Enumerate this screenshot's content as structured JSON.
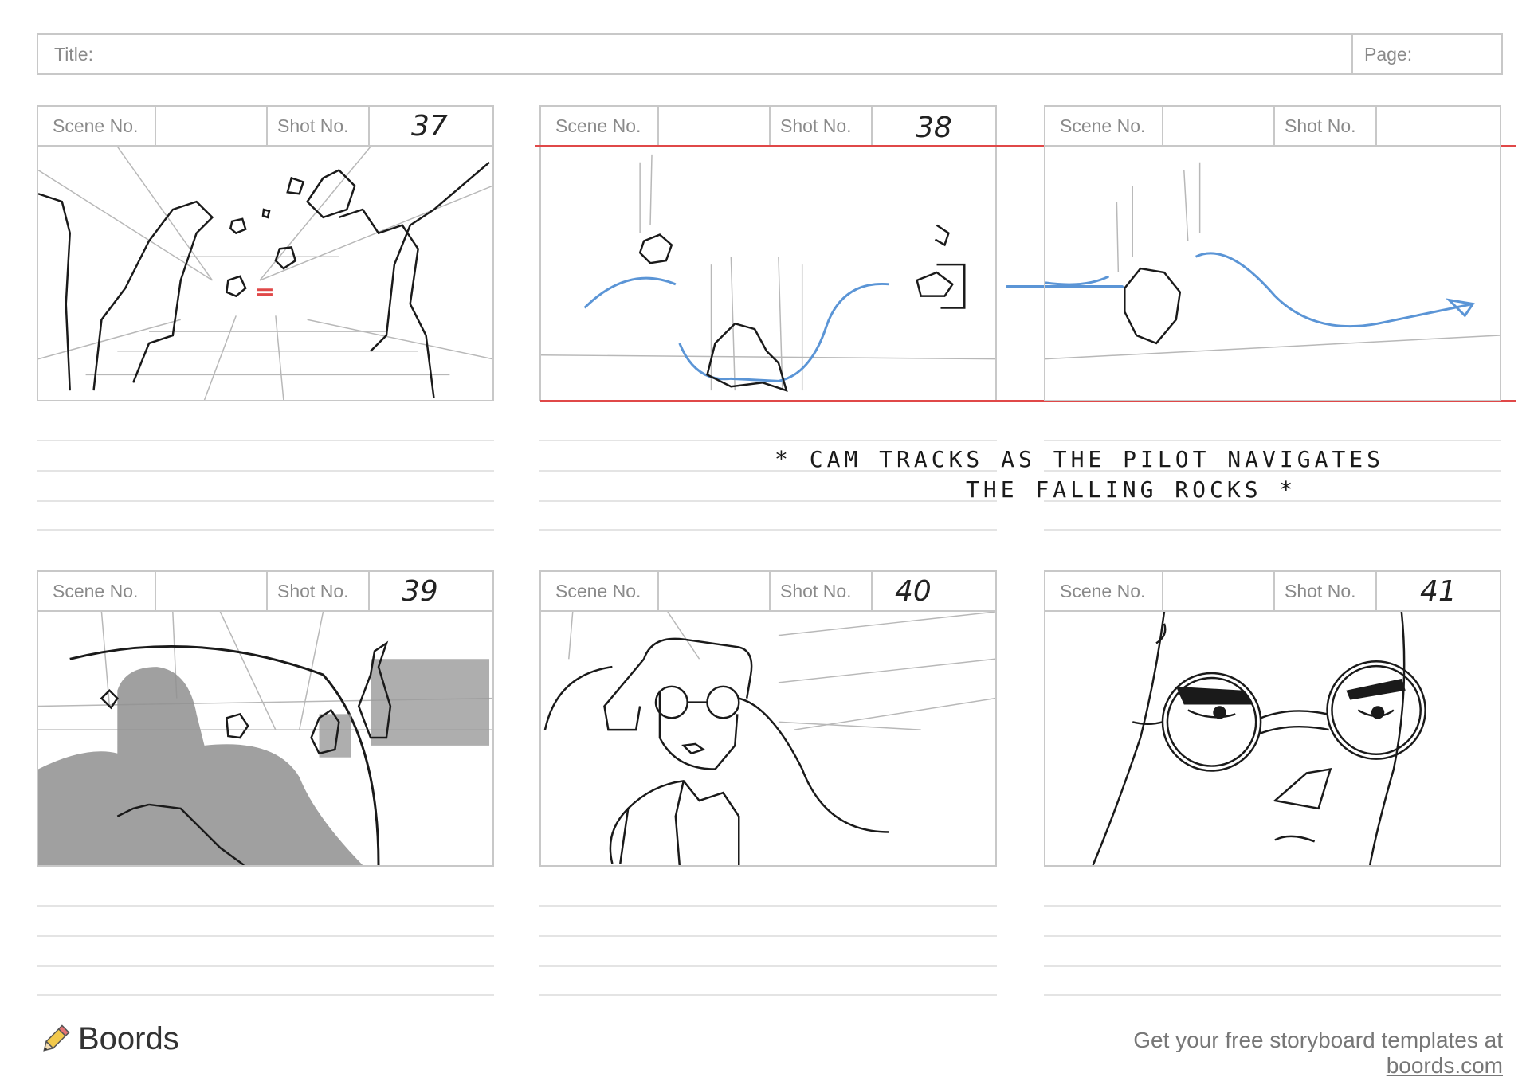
{
  "header": {
    "title_label": "Title:",
    "page_label": "Page:"
  },
  "panel_labels": {
    "scene": "Scene No.",
    "shot": "Shot No."
  },
  "panels": [
    {
      "shot": "37"
    },
    {
      "shot": "38"
    },
    {
      "shot": ""
    },
    {
      "shot": "39"
    },
    {
      "shot": "40"
    },
    {
      "shot": "41"
    }
  ],
  "note": {
    "line1": "* CAM TRACKS AS THE PILOT NAVIGATES",
    "line2": "THE FALLING ROCKS *"
  },
  "footer": {
    "brand": "Boords",
    "promo_text": "Get your free storyboard templates at ",
    "promo_link": "boords.com"
  },
  "colors": {
    "frame": "#c8c8c8",
    "red_guide": "#e04848",
    "blue_path": "#5b95d6",
    "pencil": "#1a1a1a"
  }
}
